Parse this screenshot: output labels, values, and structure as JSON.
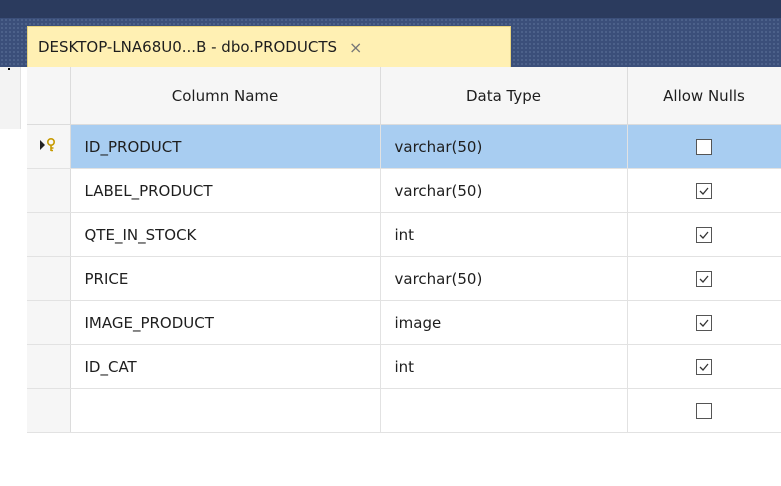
{
  "tab": {
    "title": "DESKTOP-LNA68U0...B - dbo.PRODUCTS",
    "close_glyph": "×"
  },
  "grid": {
    "headers": [
      "Column Name",
      "Data Type",
      "Allow Nulls"
    ],
    "rows": [
      {
        "name": "ID_PRODUCT",
        "type": "varchar(50)",
        "allow_nulls": false,
        "primary_key": true,
        "selected": true
      },
      {
        "name": "LABEL_PRODUCT",
        "type": "varchar(50)",
        "allow_nulls": true
      },
      {
        "name": "QTE_IN_STOCK",
        "type": "int",
        "allow_nulls": true
      },
      {
        "name": "PRICE",
        "type": "varchar(50)",
        "allow_nulls": true
      },
      {
        "name": "IMAGE_PRODUCT",
        "type": "image",
        "allow_nulls": true
      },
      {
        "name": "ID_CAT",
        "type": "int",
        "allow_nulls": true
      },
      {
        "name": "",
        "type": "",
        "allow_nulls": false
      }
    ]
  },
  "icons": {
    "row_selector": "current-row-key-icon",
    "checkbox_checked": "checkbox-checked-icon",
    "checkbox_unchecked": "checkbox-unchecked-icon"
  },
  "colors": {
    "tab_background": "#fff0b3",
    "selected_row": "#a8cdf1",
    "tabstrip": "#3b4f7a"
  }
}
